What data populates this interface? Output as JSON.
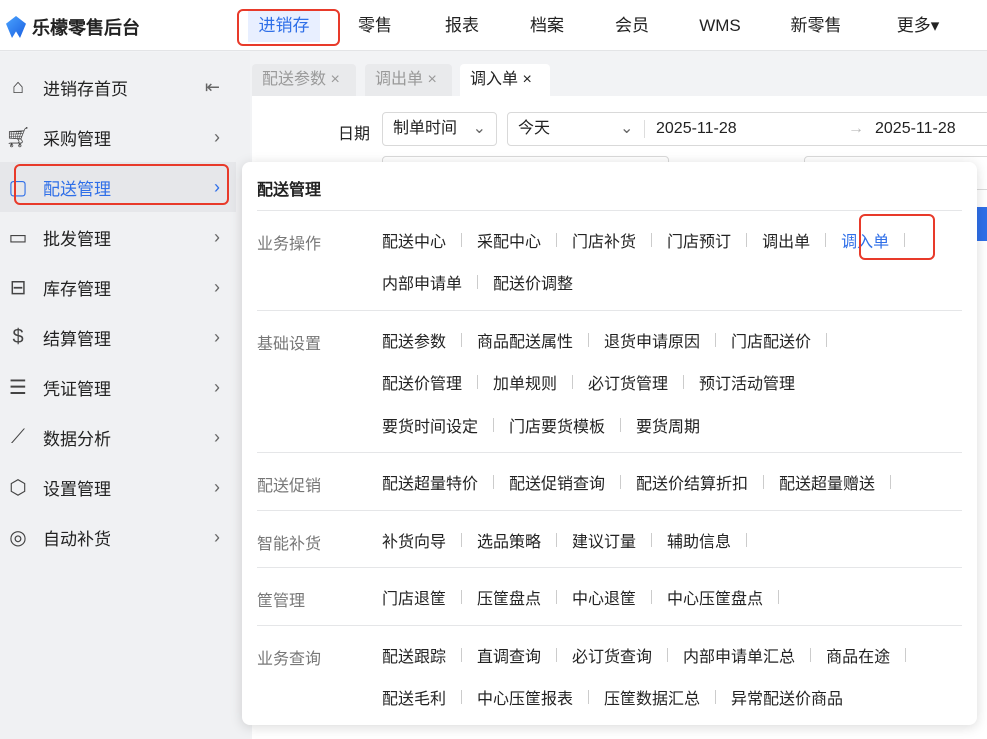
{
  "app": {
    "title": "乐檬零售后台"
  },
  "topnav": [
    {
      "label": "进销存"
    },
    {
      "label": "零售"
    },
    {
      "label": "报表"
    },
    {
      "label": "档案"
    },
    {
      "label": "会员"
    },
    {
      "label": "WMS"
    },
    {
      "label": "新零售"
    },
    {
      "label": "更多▾"
    }
  ],
  "sidebar": {
    "collapse_icon": "⇤",
    "items": [
      {
        "label": "进销存首页",
        "icon": "home-icon"
      },
      {
        "label": "采购管理",
        "icon": "cart-icon"
      },
      {
        "label": "配送管理",
        "icon": "delivery-icon"
      },
      {
        "label": "批发管理",
        "icon": "wallet-icon"
      },
      {
        "label": "库存管理",
        "icon": "box-icon"
      },
      {
        "label": "结算管理",
        "icon": "dollar-icon"
      },
      {
        "label": "凭证管理",
        "icon": "document-icon"
      },
      {
        "label": "数据分析",
        "icon": "chart-icon"
      },
      {
        "label": "设置管理",
        "icon": "settings-icon"
      },
      {
        "label": "自动补货",
        "icon": "refill-icon"
      }
    ]
  },
  "tabs": [
    {
      "label": "配送参数"
    },
    {
      "label": "调出单"
    },
    {
      "label": "调入单"
    }
  ],
  "filter": {
    "date_label": "日期",
    "date_type": "制单时间",
    "range": "今天",
    "start": "2025-11-28",
    "end": "2025-11-28"
  },
  "flyout": {
    "title": "配送管理",
    "groups": [
      {
        "label": "业务操作",
        "rows": [
          [
            "配送中心",
            "采配中心",
            "门店补货",
            "门店预订",
            "调出单",
            "调入单"
          ],
          [
            "内部申请单",
            "配送价调整"
          ]
        ]
      },
      {
        "label": "基础设置",
        "rows": [
          [
            "配送参数",
            "商品配送属性",
            "退货申请原因",
            "门店配送价"
          ],
          [
            "配送价管理",
            "加单规则",
            "必订货管理",
            "预订活动管理"
          ],
          [
            "要货时间设定",
            "门店要货模板",
            "要货周期"
          ]
        ]
      },
      {
        "label": "配送促销",
        "rows": [
          [
            "配送超量特价",
            "配送促销查询",
            "配送价结算折扣",
            "配送超量赠送"
          ]
        ]
      },
      {
        "label": "智能补货",
        "rows": [
          [
            "补货向导",
            "选品策略",
            "建议订量",
            "辅助信息"
          ]
        ]
      },
      {
        "label": "筐管理",
        "rows": [
          [
            "门店退筐",
            "压筐盘点",
            "中心退筐",
            "中心压筐盘点"
          ]
        ]
      },
      {
        "label": "业务查询",
        "rows": [
          [
            "配送跟踪",
            "直调查询",
            "必订货查询",
            "内部申请单汇总",
            "商品在途"
          ],
          [
            "配送毛利",
            "中心压筐报表",
            "压筐数据汇总",
            "异常配送价商品"
          ]
        ]
      }
    ]
  }
}
